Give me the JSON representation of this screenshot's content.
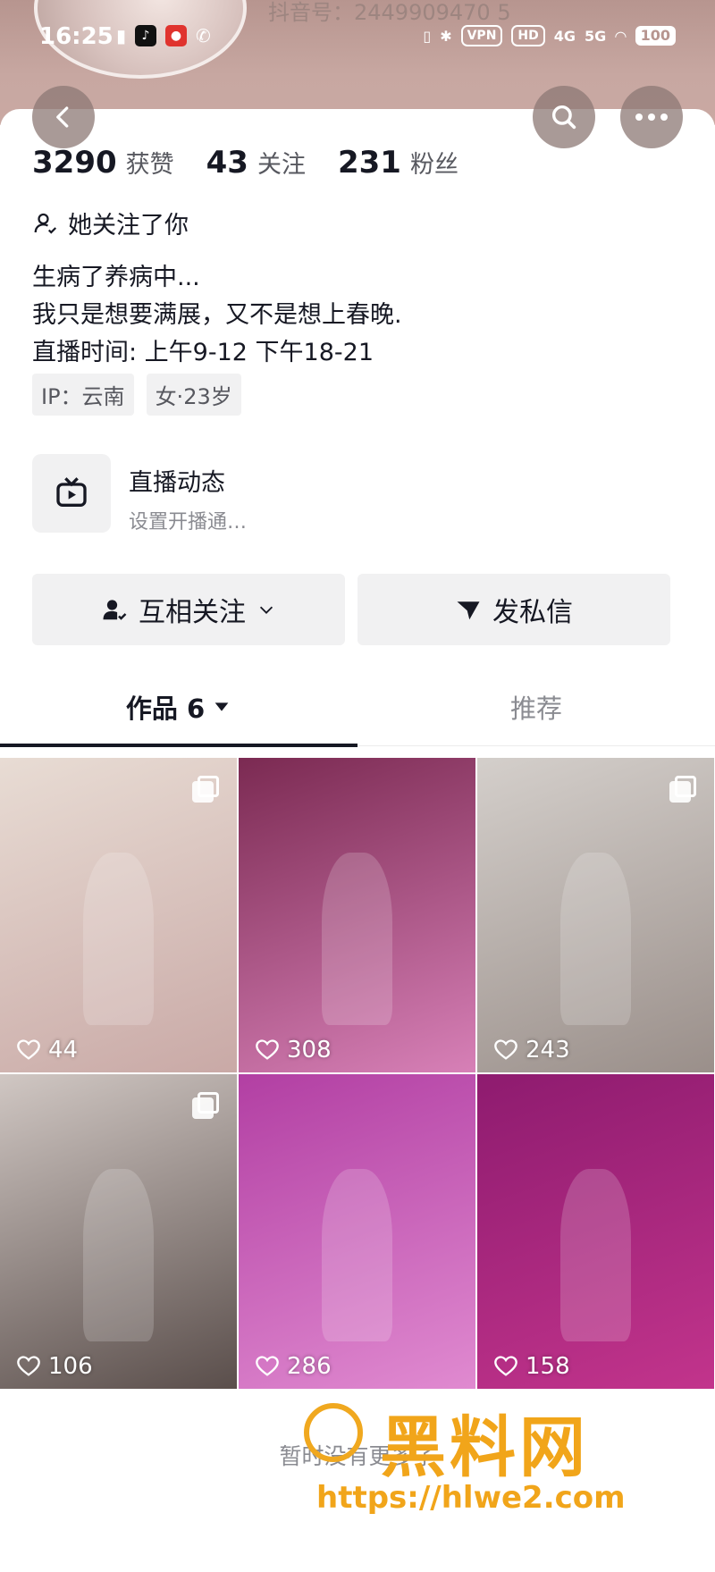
{
  "status_bar": {
    "time": "16:25",
    "battery": "100",
    "vpn": "VPN",
    "hd": "HD",
    "net1": "4G",
    "net2": "5G"
  },
  "header": {
    "account_id": "抖音号：2449909470 5"
  },
  "stats": [
    {
      "value": "3290",
      "label": "获赞"
    },
    {
      "value": "43",
      "label": "关注"
    },
    {
      "value": "231",
      "label": "粉丝"
    }
  ],
  "follows_you": "她关注了你",
  "bio": [
    "生病了养病中...",
    "我只是想要满展，又不是想上春晚.",
    "直播时间: 上午9-12  下午18-21"
  ],
  "tags": [
    "IP：云南",
    "女·23岁"
  ],
  "live": {
    "title": "直播动态",
    "subtitle": "设置开播通…"
  },
  "actions": {
    "follow_label": "互相关注",
    "message_label": "发私信"
  },
  "tabs": [
    {
      "label": "作品 6"
    },
    {
      "label": "推荐"
    }
  ],
  "posts": [
    {
      "likes": "44",
      "multi": true,
      "colors": [
        "#e8dcd4",
        "#c9a9a6"
      ]
    },
    {
      "likes": "308",
      "multi": false,
      "colors": [
        "#7b2a52",
        "#d780b7"
      ]
    },
    {
      "likes": "243",
      "multi": true,
      "colors": [
        "#d4cfcb",
        "#9a8f8a"
      ]
    },
    {
      "likes": "106",
      "multi": true,
      "colors": [
        "#d0c7c3",
        "#5a4e4b"
      ]
    },
    {
      "likes": "286",
      "multi": false,
      "colors": [
        "#b23fa3",
        "#e08ad0"
      ]
    },
    {
      "likes": "158",
      "multi": false,
      "colors": [
        "#8e1b6f",
        "#c2348c"
      ]
    }
  ],
  "footer": "暂时没有更多了",
  "watermark": {
    "text": "黑料网",
    "url": "https://hlwe2.com"
  },
  "colors": {
    "primary_text": "#161823",
    "secondary_text": "#57585f",
    "muted": "#8a8b91",
    "button_bg": "#f1f1f2",
    "watermark": "#f1a51a"
  }
}
